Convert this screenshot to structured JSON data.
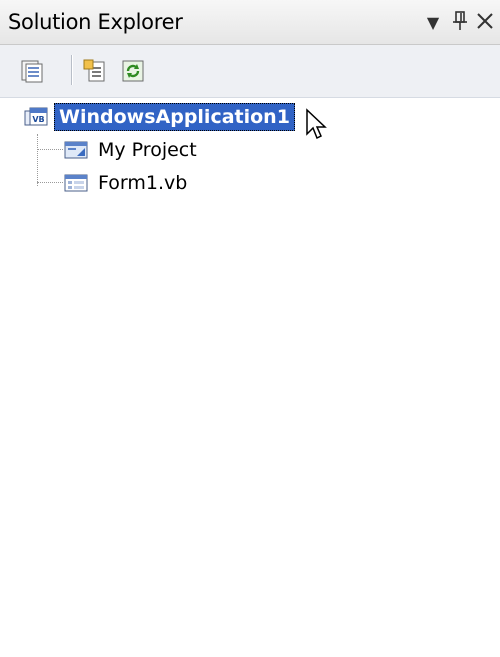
{
  "panel": {
    "title": "Solution Explorer",
    "buttons": {
      "dropdown_icon": "triangle-down",
      "pin_icon": "pin",
      "close_icon": "close"
    }
  },
  "toolbar": {
    "items": [
      {
        "name": "show-all-files",
        "icon": "show-all-files-icon"
      },
      {
        "name": "properties",
        "icon": "properties-icon"
      },
      {
        "name": "refresh",
        "icon": "refresh-icon"
      }
    ]
  },
  "tree": {
    "root": {
      "label": "WindowsApplication1",
      "selected": true,
      "icon": "vb-project-icon"
    },
    "children": [
      {
        "label": "My Project",
        "icon": "my-project-icon"
      },
      {
        "label": "Form1.vb",
        "icon": "form-icon"
      }
    ]
  },
  "colors": {
    "selection": "#3163c5",
    "toolbar": "#eef0f4",
    "titlebar": "#e6e6e6"
  }
}
